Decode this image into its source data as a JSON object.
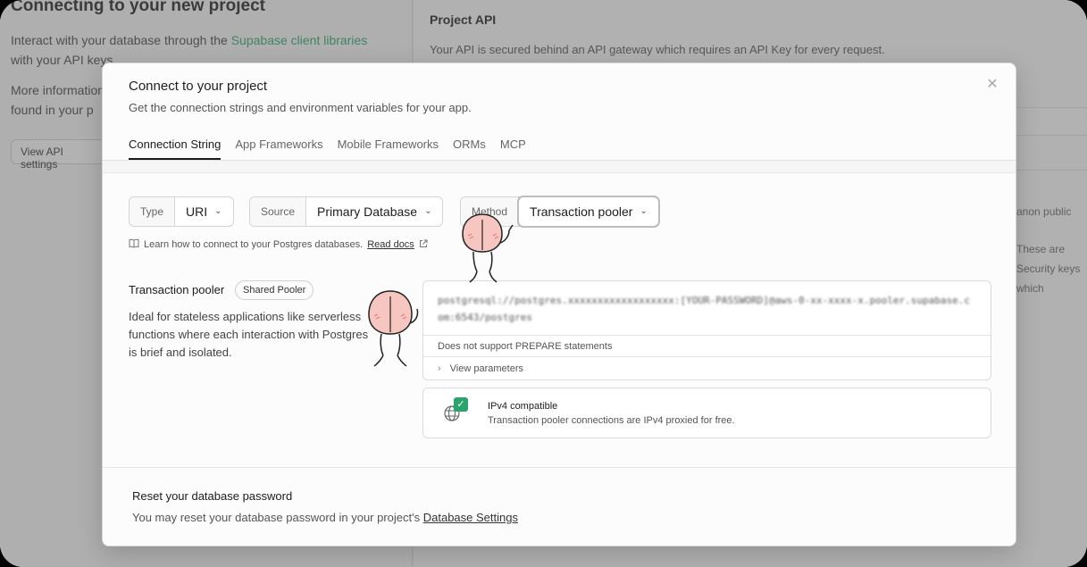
{
  "background": {
    "title": "Connecting to your new project",
    "para_start": "Interact with your database through the ",
    "para_link": "Supabase client libraries",
    "para_end": " with your API keys.",
    "para2": "More information found in your p",
    "button": "View API settings",
    "right_title": "Project API",
    "right_text": "Your API is secured behind an API gateway which requires an API Key for every request.",
    "right_text2": "anon  public",
    "right_text3": "These are Security keys which"
  },
  "modal": {
    "title": "Connect to your project",
    "subtitle": "Get the connection strings and environment variables for your app.",
    "tabs": [
      "Connection String",
      "App Frameworks",
      "Mobile Frameworks",
      "ORMs",
      "MCP"
    ],
    "selects": {
      "type_label": "Type",
      "type_value": "URI",
      "source_label": "Source",
      "source_value": "Primary Database",
      "method_label": "Method",
      "method_value": "Transaction pooler"
    },
    "learn_text": "Learn how to connect to your Postgres databases.",
    "learn_link": "Read docs",
    "pooler": {
      "title": "Transaction pooler",
      "badge": "Shared Pooler",
      "description": "Ideal for stateless applications like serverless functions where each interaction with Postgres is brief and isolated."
    },
    "connection": {
      "string": "postgresql://postgres.xxxxxxxxxxxxxxxxxx:[YOUR-PASSWORD]@aws-0-xx-xxxx-x.pooler.supabase.com:6543/postgres",
      "warning": "Does not support PREPARE statements",
      "params": "View parameters"
    },
    "ipv4": {
      "title": "IPv4 compatible",
      "subtitle": "Transaction pooler connections are IPv4 proxied for free."
    },
    "footer": {
      "title": "Reset your database password",
      "text": "You may reset your database password in your project's ",
      "link": "Database Settings"
    }
  },
  "colors": {
    "accent_green": "#2aa46a",
    "sticker_pink": "#f7c6c0"
  },
  "icons": {
    "close": "close-icon",
    "book": "book-icon",
    "external": "external-link-icon",
    "globe": "globe-icon",
    "check": "check-icon"
  }
}
